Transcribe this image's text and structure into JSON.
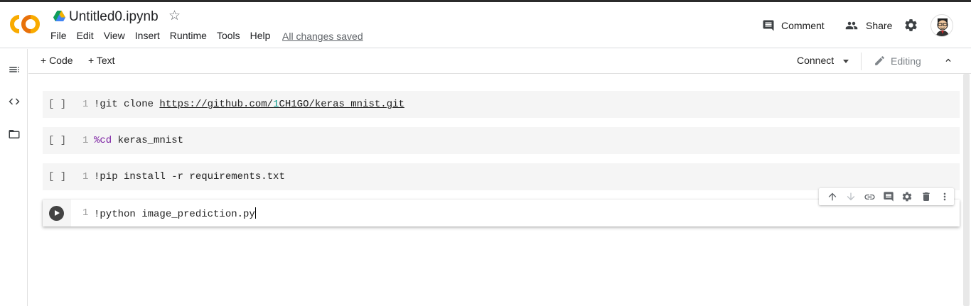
{
  "header": {
    "title": "Untitled0.ipynb",
    "menu": [
      "File",
      "Edit",
      "View",
      "Insert",
      "Runtime",
      "Tools",
      "Help"
    ],
    "save_status": "All changes saved",
    "comment_label": "Comment",
    "share_label": "Share"
  },
  "toolbar": {
    "add_code": "+ Code",
    "add_text": "+ Text",
    "connect": "Connect",
    "editing": "Editing"
  },
  "cells": [
    {
      "bracket": "[ ]",
      "line": "1",
      "bang": "!git clone ",
      "link_pre": "https://github.com/",
      "link_teal": "1",
      "link_post": "CH1GO/keras_mnist.git"
    },
    {
      "bracket": "[ ]",
      "line": "1",
      "magic": "%cd",
      "rest": " keras_mnist"
    },
    {
      "bracket": "[ ]",
      "line": "1",
      "code": "!pip install -r requirements.txt"
    },
    {
      "line": "1",
      "code": "!python image_prediction.py"
    }
  ],
  "colors": {
    "accent_orange": "#F9AB00",
    "teal": "#009688",
    "magic": "#7B1FA2"
  },
  "icons": [
    "colab-logo",
    "drive-icon",
    "star-icon",
    "comment-icon",
    "share-icon",
    "settings-icon",
    "avatar",
    "toc-icon",
    "code-snippets-icon",
    "files-icon",
    "edit-icon",
    "collapse-icon",
    "run-icon",
    "move-up-icon",
    "move-down-icon",
    "link-icon",
    "comment-icon",
    "settings-icon",
    "delete-icon",
    "more-icon"
  ]
}
